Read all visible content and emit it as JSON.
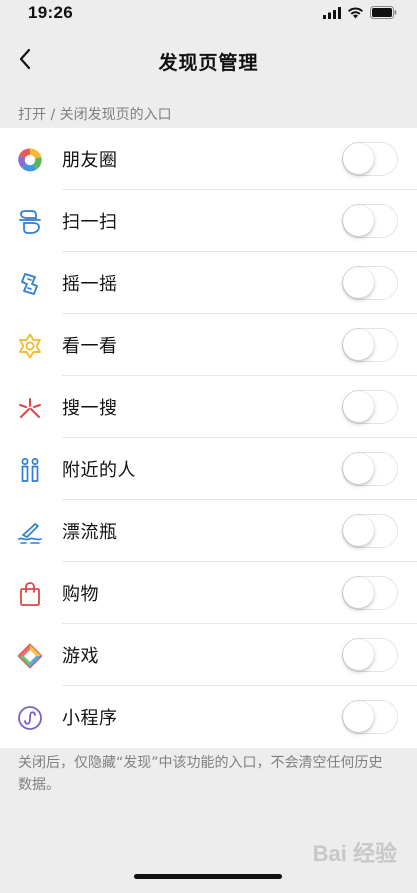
{
  "status_bar": {
    "time": "19:26"
  },
  "nav": {
    "title": "发现页管理"
  },
  "section_label": "打开 / 关闭发现页的入口",
  "items": [
    {
      "label": "朋友圈",
      "icon": "moments-icon",
      "enabled": false
    },
    {
      "label": "扫一扫",
      "icon": "scan-icon",
      "enabled": false
    },
    {
      "label": "摇一摇",
      "icon": "shake-icon",
      "enabled": false
    },
    {
      "label": "看一看",
      "icon": "top-stories-icon",
      "enabled": false
    },
    {
      "label": "搜一搜",
      "icon": "search-icon",
      "enabled": false
    },
    {
      "label": "附近的人",
      "icon": "people-nearby-icon",
      "enabled": false
    },
    {
      "label": "漂流瓶",
      "icon": "drift-bottle-icon",
      "enabled": false
    },
    {
      "label": "购物",
      "icon": "shopping-bag-icon",
      "enabled": false
    },
    {
      "label": "游戏",
      "icon": "games-icon",
      "enabled": false
    },
    {
      "label": "小程序",
      "icon": "mini-programs-icon",
      "enabled": false
    }
  ],
  "footer_note": "关闭后，仅隐藏“发现”中该功能的入口，不会清空任何历史数据。",
  "watermark": "Bai 经验",
  "colors": {
    "background": "#ededed",
    "list_bg": "#ffffff",
    "secondary_text": "#808080"
  }
}
